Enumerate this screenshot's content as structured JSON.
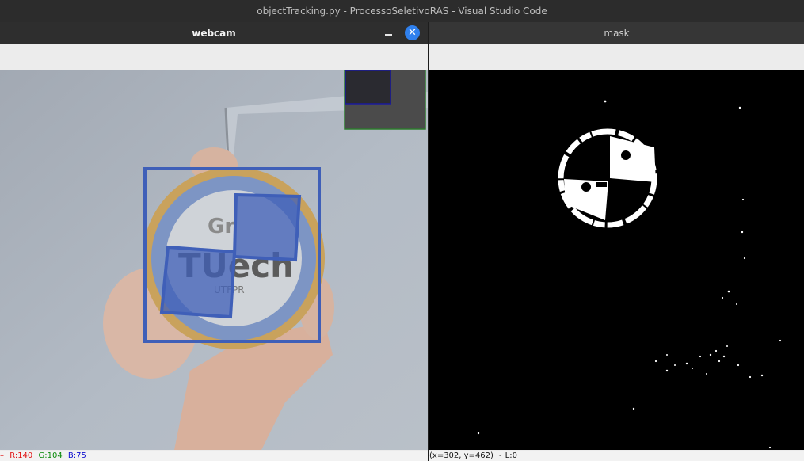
{
  "app": {
    "title": "objectTracking.py - ProcessoSeletivoRAS - Visual Studio Code"
  },
  "webcam_window": {
    "title": "webcam",
    "status": {
      "prefix": "–",
      "r": "R:140",
      "g": "G:104",
      "b": "B:75"
    },
    "colors": {
      "r": "#e01010",
      "g": "#0a8a0a",
      "b": "#1010d0",
      "overlay": "#3f5fb8"
    }
  },
  "mask_window": {
    "title": "mask",
    "status": {
      "text": "(x=302, y=462) ~ L:0"
    }
  },
  "icons": {
    "minimize": "minimize-icon",
    "close": "close-icon"
  }
}
